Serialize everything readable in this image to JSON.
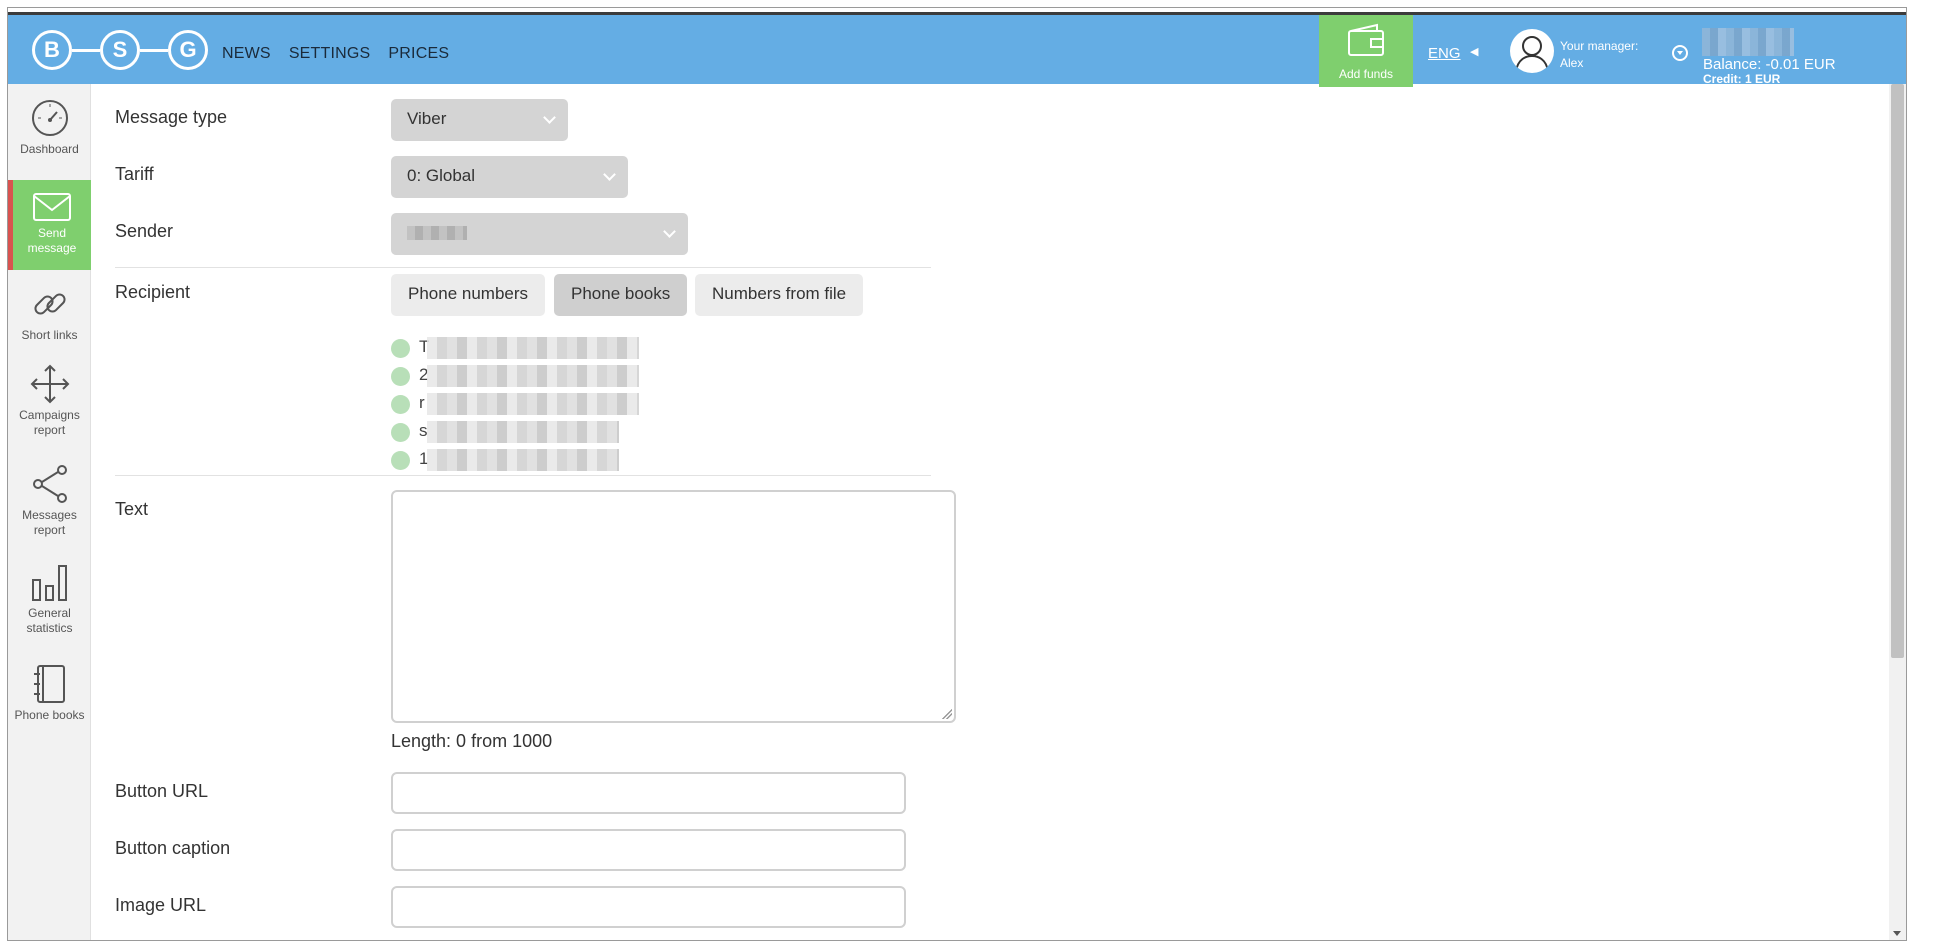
{
  "header": {
    "logo_letters": [
      "B",
      "S",
      "G"
    ],
    "nav": [
      "NEWS",
      "SETTINGS",
      "PRICES"
    ],
    "add_funds_label": "Add funds",
    "language": "ENG",
    "manager_label": "Your manager:",
    "manager_name": "Alex",
    "balance_text": "Balance: -0.01 EUR",
    "credit_text": "Credit: 1 EUR"
  },
  "sidebar": {
    "items": [
      {
        "label": "Dashboard",
        "icon": "speedometer-icon"
      },
      {
        "label": "Send message",
        "icon": "envelope-icon",
        "active": true
      },
      {
        "label": "Short links",
        "icon": "link-icon"
      },
      {
        "label": "Campaigns report",
        "icon": "move-arrows-icon"
      },
      {
        "label": "Messages report",
        "icon": "share-icon"
      },
      {
        "label": "General statistics",
        "icon": "bar-chart-icon"
      },
      {
        "label": "Phone books",
        "icon": "notebook-icon"
      }
    ]
  },
  "form": {
    "message_type_label": "Message type",
    "message_type_value": "Viber",
    "tariff_label": "Tariff",
    "tariff_value": "0: Global",
    "sender_label": "Sender",
    "recipient_label": "Recipient",
    "recipient_tabs": [
      "Phone numbers",
      "Phone books",
      "Numbers from file"
    ],
    "recipient_active_tab": "Phone books",
    "phone_books": [
      {
        "text": "T"
      },
      {
        "text": "2"
      },
      {
        "text": "r"
      },
      {
        "text": "s"
      },
      {
        "text": "1"
      }
    ],
    "text_label": "Text",
    "length_text": "Length: 0 from 1000",
    "button_url_label": "Button URL",
    "button_caption_label": "Button caption",
    "image_url_label": "Image URL"
  },
  "colors": {
    "header": "#64ade4",
    "add_funds": "#7fcf6e",
    "active_sidebar": "#7fcf6e",
    "active_marker": "#d9534f"
  }
}
